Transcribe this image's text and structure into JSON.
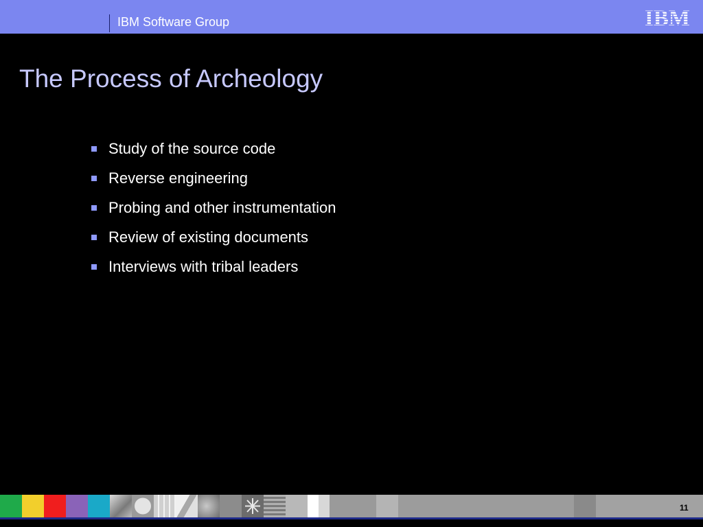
{
  "header": {
    "group_label": "IBM Software Group",
    "logo_text": "IBM",
    "bar_color": "#7b86f0"
  },
  "slide": {
    "title": "The Process of Archeology",
    "title_color": "#c7c9ff",
    "bullets": [
      "Study of the source code",
      "Reverse engineering",
      "Probing and other instrumentation",
      "Review of existing documents",
      "Interviews with tribal leaders"
    ],
    "bullet_color": "#8f9aff"
  },
  "footer": {
    "page_number": "11",
    "tile_colors": [
      "#1faa4a",
      "#f2cf2c",
      "#f01e1e",
      "#8a63b8",
      "#1aa9c8"
    ],
    "bottom_line_color": "#1e2a8a"
  }
}
